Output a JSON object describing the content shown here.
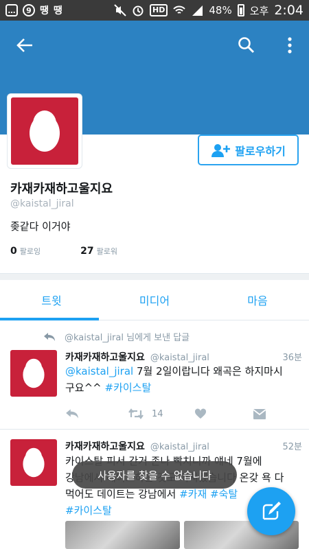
{
  "status_bar": {
    "left_icons": [
      "message-icon",
      "g-app-icon",
      "talk-icon",
      "talk-icon"
    ],
    "talk_label": "땡",
    "g_label": "9",
    "network_label": "HD",
    "battery": "48%",
    "time_prefix": "오후",
    "time": "2:04"
  },
  "colors": {
    "header": "#2c82c2",
    "accent": "#1da1f2",
    "avatar_bg": "#c8213a"
  },
  "profile": {
    "name": "카재카재하고울지요",
    "handle": "@kaistal_jiral",
    "bio": "좆같다 이거야",
    "following_count": "0",
    "following_label": "팔로잉",
    "followers_count": "27",
    "followers_label": "팔로워",
    "follow_button": "팔로우하기"
  },
  "tabs": [
    {
      "label": "트윗",
      "active": true
    },
    {
      "label": "미디어",
      "active": false
    },
    {
      "label": "마음",
      "active": false
    }
  ],
  "tweets": [
    {
      "reply_handle": "@kaistal_jiral",
      "reply_suffix": "님에게 보낸 답글",
      "name": "카재카재하고울지요",
      "handle": "@kaistal_jiral",
      "time": "36분",
      "mention": "@kaistal_jiral",
      "text_mid": " 7월 2일이랍니다 왜곡은 하지마시구요^^ ",
      "hashtag": "#카이스탈",
      "retweets": "14"
    },
    {
      "name": "카재카재하고울지요",
      "handle": "@kaistal_jiral",
      "time": "52분",
      "line1": "카이스탈 피서 간거 존나 빡치니까 얘네 7월에",
      "line2": "강남에서 데이트하는 것도 미치겠습니다 온갖 욕 다",
      "line3_text": "먹어도 데이트는 강남에서 ",
      "line3_tags": "#카재 #숙탈",
      "line4_tag": "#카이스탈"
    }
  ],
  "toast": "사용자를 찾을 수 없습니다"
}
